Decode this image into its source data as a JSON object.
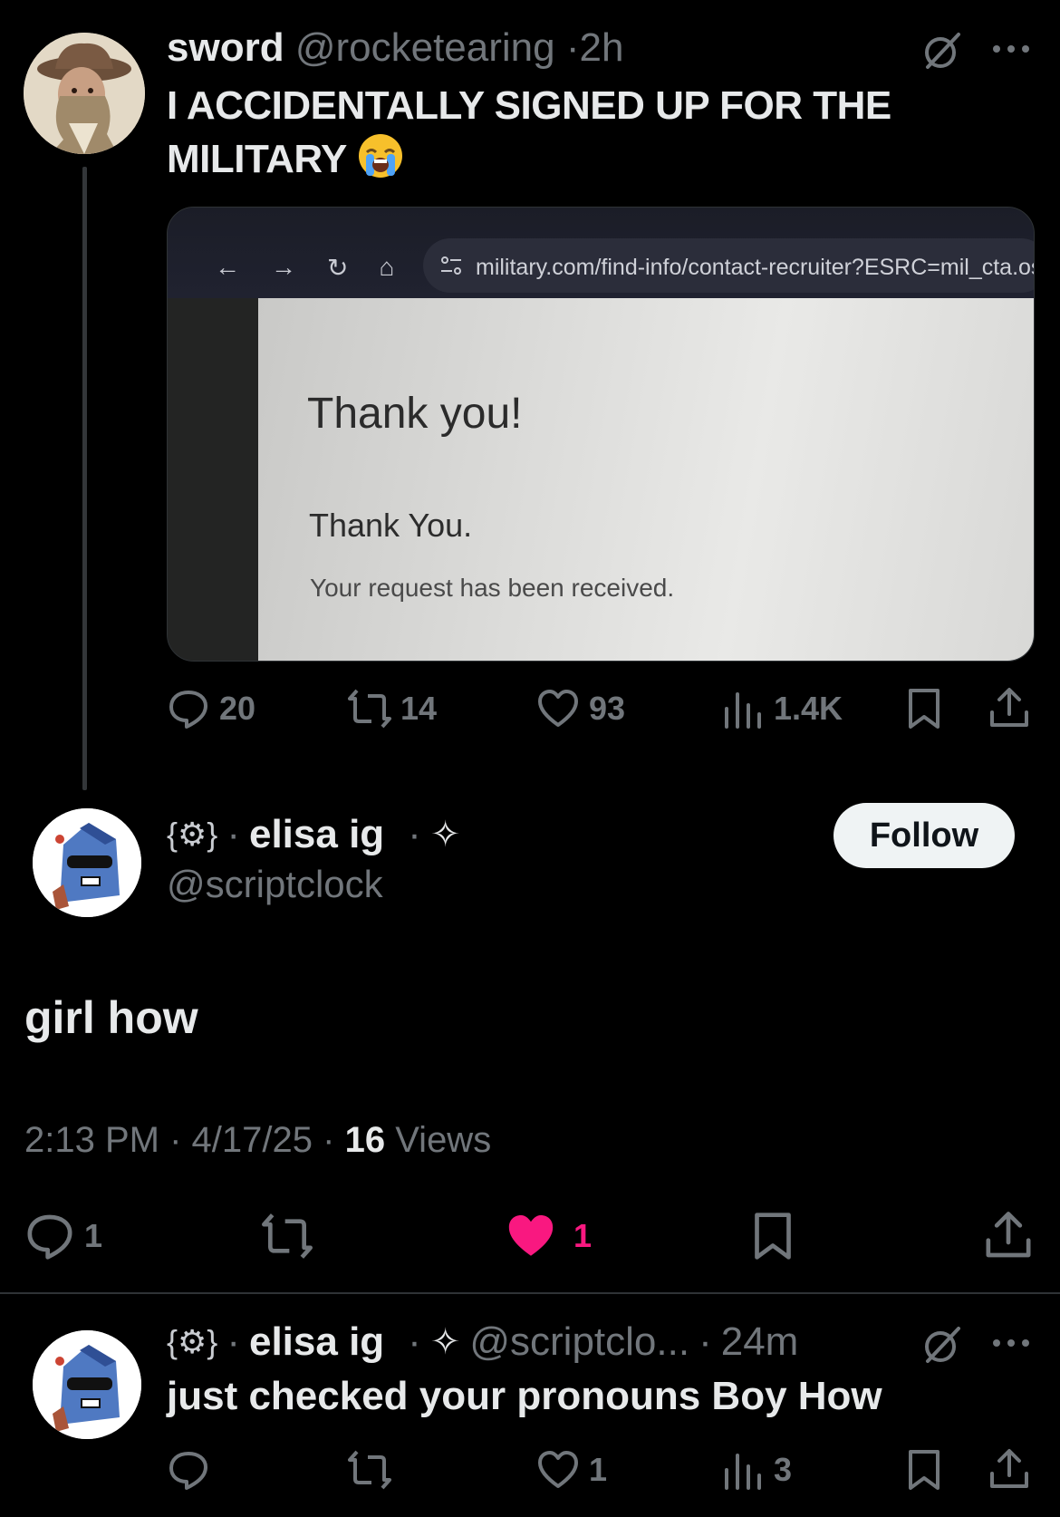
{
  "tweet1": {
    "name": "sword",
    "handle": "@rocketearing",
    "time": "2h",
    "text": "I ACCIDENTALLY SIGNED UP FOR THE MILITARY",
    "emoji": "loudly-crying-face",
    "media": {
      "url": "military.com/find-info/contact-recruiter?ESRC=mil_cta.os",
      "heading": "Thank you!",
      "subheading": "Thank You.",
      "body": "Your request has been received."
    },
    "stats": {
      "replies": "20",
      "reposts": "14",
      "likes": "93",
      "views": "1.4K"
    }
  },
  "reply_main": {
    "name_deco": "{⚙}",
    "name": "elisa ig",
    "sparkle": "✧",
    "handle": "@scriptclock",
    "follow_label": "Follow",
    "text": "girl how",
    "time": "2:13 PM",
    "date": "4/17/25",
    "views_count": "16",
    "views_label": "Views",
    "stats": {
      "replies": "1",
      "likes": "1"
    },
    "like_color": "#f91880"
  },
  "reply2": {
    "name": "elisa ig",
    "handle": "@scriptclo...",
    "time": "24m",
    "text": "just checked your pronouns Boy How",
    "stats": {
      "likes": "1",
      "views": "3"
    }
  },
  "separator": "·"
}
